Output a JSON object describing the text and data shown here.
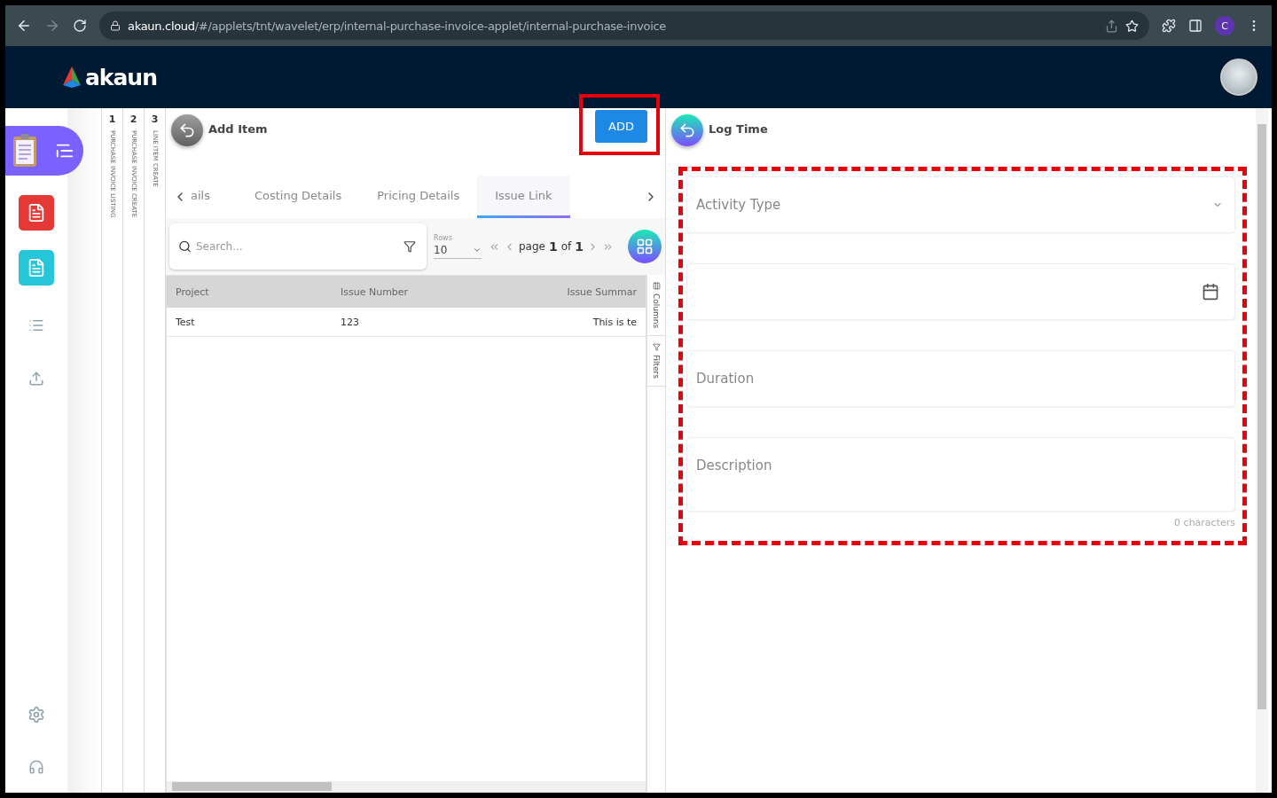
{
  "browser": {
    "url_host": "akaun.cloud",
    "url_path": "/#/applets/tnt/wavelet/erp/internal-purchase-invoice-applet/internal-purchase-invoice",
    "profile_initial": "C"
  },
  "header": {
    "logo": "akaun"
  },
  "steps": [
    {
      "number": "1",
      "label": "PURCHASE INVOICE LISTING"
    },
    {
      "number": "2",
      "label": "PURCHASE INVOICE CREATE"
    },
    {
      "number": "3",
      "label": "LINE ITEM CREATE"
    }
  ],
  "add_item": {
    "title": "Add Item",
    "add_button": "ADD",
    "tabs": [
      {
        "label": "ails",
        "selected": false
      },
      {
        "label": "Costing Details",
        "selected": false
      },
      {
        "label": "Pricing Details",
        "selected": false
      },
      {
        "label": "Issue Link",
        "selected": true
      }
    ],
    "search": {
      "placeholder": "Search..."
    },
    "rows": {
      "label": "Rows",
      "value": "10"
    },
    "pagination": {
      "page_label": "page",
      "page": "1",
      "of_label": "of",
      "total": "1"
    },
    "table": {
      "columns": [
        "Project",
        "Issue Number",
        "Issue Summar"
      ],
      "rows": [
        [
          "Test",
          "123",
          "This is te"
        ]
      ]
    },
    "side_tabs": [
      "Columns",
      "Filters"
    ]
  },
  "log_time": {
    "title": "Log Time",
    "fields": [
      {
        "kind": "select",
        "placeholder": "Activity Type"
      },
      {
        "kind": "date"
      },
      {
        "kind": "text",
        "placeholder": "Duration"
      },
      {
        "kind": "textarea",
        "placeholder": "Description",
        "counter": "0 characters"
      }
    ]
  }
}
